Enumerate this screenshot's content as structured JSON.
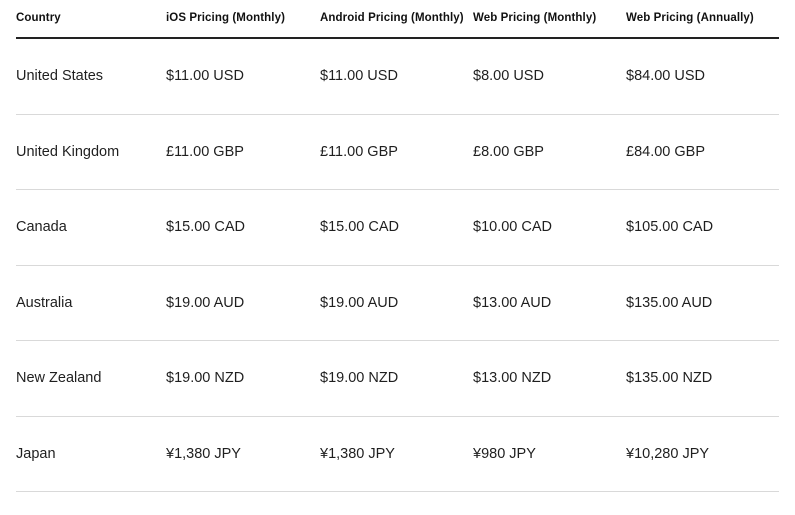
{
  "table": {
    "columns": [
      "Country",
      "iOS Pricing (Monthly)",
      "Android Pricing (Monthly)",
      "Web Pricing (Monthly)",
      "Web Pricing (Annually)"
    ],
    "rows": [
      {
        "country": "United States",
        "ios_monthly": "$11.00 USD",
        "android_monthly": "$11.00 USD",
        "web_monthly": "$8.00 USD",
        "web_annually": "$84.00 USD"
      },
      {
        "country": "United Kingdom",
        "ios_monthly": "£11.00 GBP",
        "android_monthly": "£11.00 GBP",
        "web_monthly": "£8.00 GBP",
        "web_annually": "£84.00 GBP"
      },
      {
        "country": "Canada",
        "ios_monthly": "$15.00 CAD",
        "android_monthly": "$15.00 CAD",
        "web_monthly": "$10.00 CAD",
        "web_annually": "$105.00 CAD"
      },
      {
        "country": "Australia",
        "ios_monthly": "$19.00 AUD",
        "android_monthly": "$19.00 AUD",
        "web_monthly": "$13.00 AUD",
        "web_annually": "$135.00 AUD"
      },
      {
        "country": "New Zealand",
        "ios_monthly": "$19.00 NZD",
        "android_monthly": "$19.00 NZD",
        "web_monthly": "$13.00 NZD",
        "web_annually": "$135.00 NZD"
      },
      {
        "country": "Japan",
        "ios_monthly": "¥1,380 JPY",
        "android_monthly": "¥1,380 JPY",
        "web_monthly": "¥980 JPY",
        "web_annually": "¥10,280 JPY"
      }
    ]
  },
  "colors": {
    "header_rule": "#222222",
    "row_rule": "#d9d9d9",
    "header_text": "#111111",
    "body_text": "#1f1f1f",
    "background": "#ffffff"
  }
}
